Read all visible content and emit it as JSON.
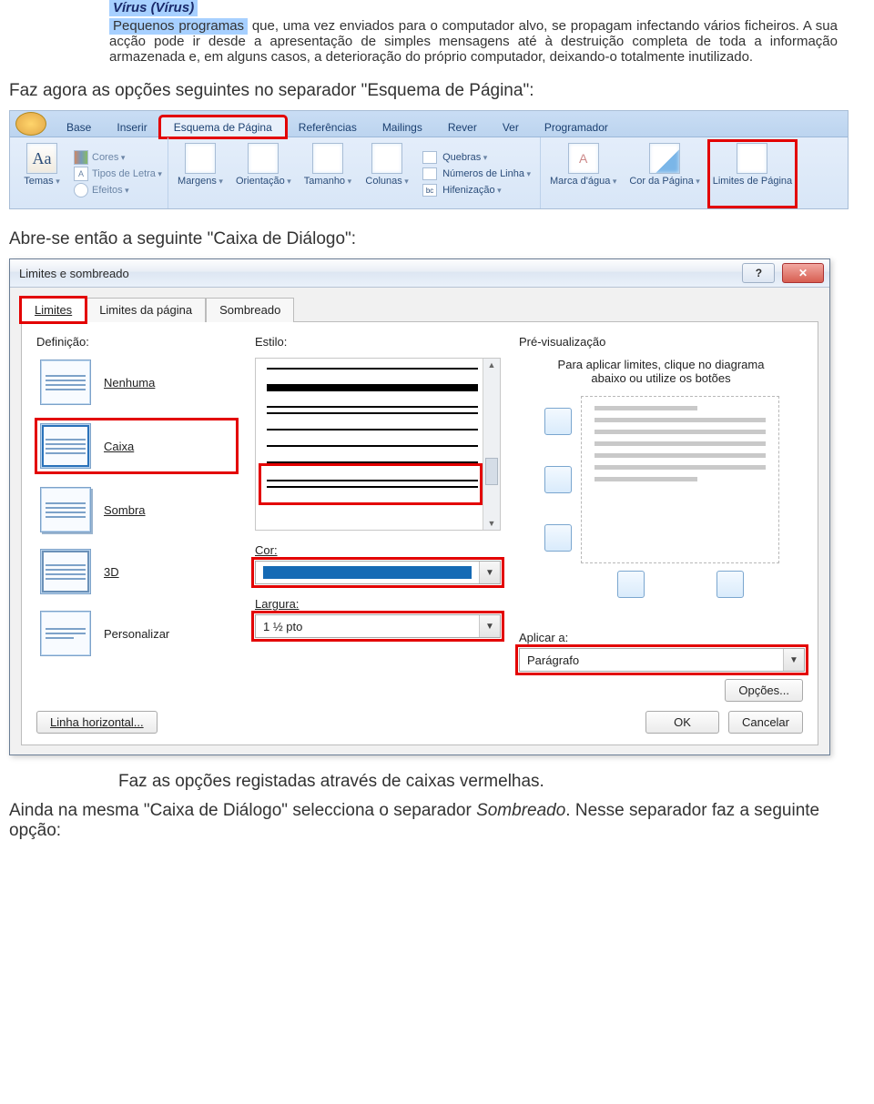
{
  "definition": {
    "title": "Vírus (Vírus)",
    "line1_hl": "Pequenos  programas",
    "body": " que, uma vez enviados para o computador alvo, se propagam infectando vários ficheiros. A sua acção pode ir desde a apresentação de simples mensagens até à destruição completa de toda a informação armazenada e, em alguns casos, a deterioração do próprio computador, deixando-o totalmente inutilizado."
  },
  "instr1": "Faz agora as opções seguintes no separador \"Esquema de Página\":",
  "ribbon": {
    "tabs": [
      "Base",
      "Inserir",
      "Esquema de Página",
      "Referências",
      "Mailings",
      "Rever",
      "Ver",
      "Programador"
    ],
    "themes": {
      "label": "Temas",
      "cores": "Cores",
      "tipos": "Tipos de Letra",
      "efeitos": "Efeitos"
    },
    "page_setup": {
      "margens": "Margens",
      "orientacao": "Orientação",
      "tamanho": "Tamanho",
      "colunas": "Colunas",
      "quebras": "Quebras",
      "numeros": "Números de Linha",
      "hifen": "Hifenização"
    },
    "bg": {
      "marca": "Marca d'água",
      "cor": "Cor da Página",
      "limites": "Limites de Página"
    }
  },
  "instr2": "Abre-se então a seguinte \"Caixa de Diálogo\":",
  "dialog": {
    "title": "Limites e sombreado",
    "tabs": [
      "Limites",
      "Limites da página",
      "Sombreado"
    ],
    "section_def": "Definição:",
    "defs": {
      "nenhuma": "Nenhuma",
      "caixa": "Caixa",
      "sombra": "Sombra",
      "tresd": "3D",
      "pers": "Personalizar"
    },
    "section_style": "Estilo:",
    "cor_label": "Cor:",
    "largura_label": "Largura:",
    "largura_val": "1 ½ pto",
    "section_preview": "Pré-visualização",
    "preview_hint": "Para aplicar limites, clique no diagrama abaixo ou utilize os botões",
    "aplicar_label": "Aplicar a:",
    "aplicar_val": "Parágrafo",
    "opcoes": "Opções...",
    "linha": "Linha horizontal...",
    "ok": "OK",
    "cancel": "Cancelar"
  },
  "instr3": "Faz as opções registadas através de caixas vermelhas.",
  "instr4a": "Ainda na mesma \"Caixa de Diálogo\" selecciona o separador ",
  "instr4b": "Sombreado",
  "instr4c": ". Nesse separador faz a seguinte opção:"
}
